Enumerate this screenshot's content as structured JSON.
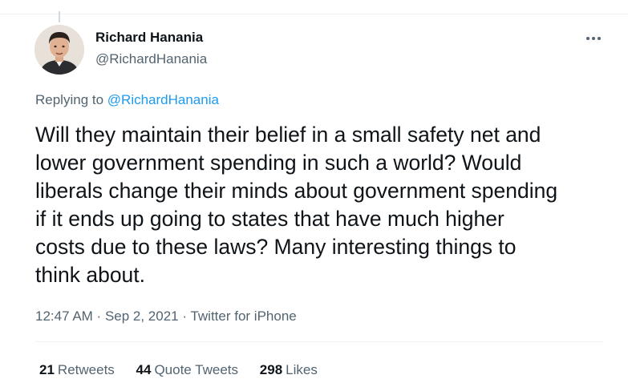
{
  "tweet": {
    "author": {
      "name": "Richard Hanania",
      "handle": "@RichardHanania"
    },
    "replying_label": "Replying to ",
    "replying_handle": "@RichardHanania",
    "text_lines": [
      "Will they maintain their belief in a small safety net and",
      "lower government spending in such a world? Would",
      "liberals change their minds about government spending",
      "if it ends up going to states that have much higher",
      "costs due to these laws? Many interesting things to",
      "think about."
    ],
    "time": "12:47 AM",
    "dot1": " · ",
    "date": "Sep 2, 2021",
    "dot2": " · ",
    "source": "Twitter for iPhone",
    "stats": {
      "retweets_count": "21",
      "retweets_label": "Retweets",
      "quotes_count": "44",
      "quotes_label": "Quote Tweets",
      "likes_count": "298",
      "likes_label": "Likes"
    },
    "more_icon": "more-horizontal-icon"
  },
  "colors": {
    "text": "#0f1419",
    "secondary": "#536471",
    "link": "#1d9bf0",
    "border": "#eff3f4"
  }
}
